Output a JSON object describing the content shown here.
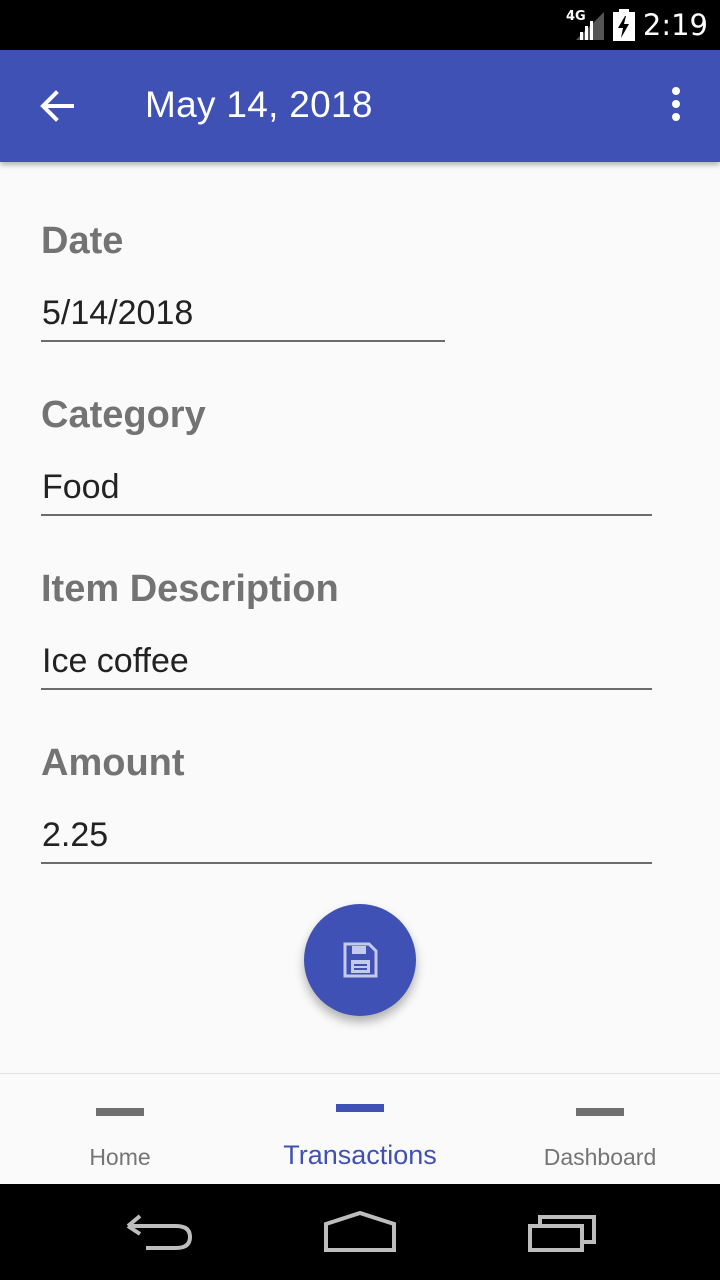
{
  "status_bar": {
    "network": "4G",
    "time": "2:19"
  },
  "toolbar": {
    "title": "May 14, 2018",
    "back_icon": "arrow-back-icon",
    "overflow_icon": "more-vert-icon"
  },
  "form": {
    "date": {
      "label": "Date",
      "value": "5/14/2018"
    },
    "category": {
      "label": "Category",
      "value": "Food"
    },
    "description": {
      "label": "Item Description",
      "value": "Ice coffee"
    },
    "amount": {
      "label": "Amount",
      "value": "2.25"
    }
  },
  "save_fab": {
    "icon": "save-icon"
  },
  "bottom_nav": {
    "items": [
      {
        "label": "Home",
        "active": false
      },
      {
        "label": "Transactions",
        "active": true
      },
      {
        "label": "Dashboard",
        "active": false
      }
    ]
  },
  "colors": {
    "primary": "#3f51b5",
    "label_gray": "#737373",
    "background": "#fafafa"
  }
}
